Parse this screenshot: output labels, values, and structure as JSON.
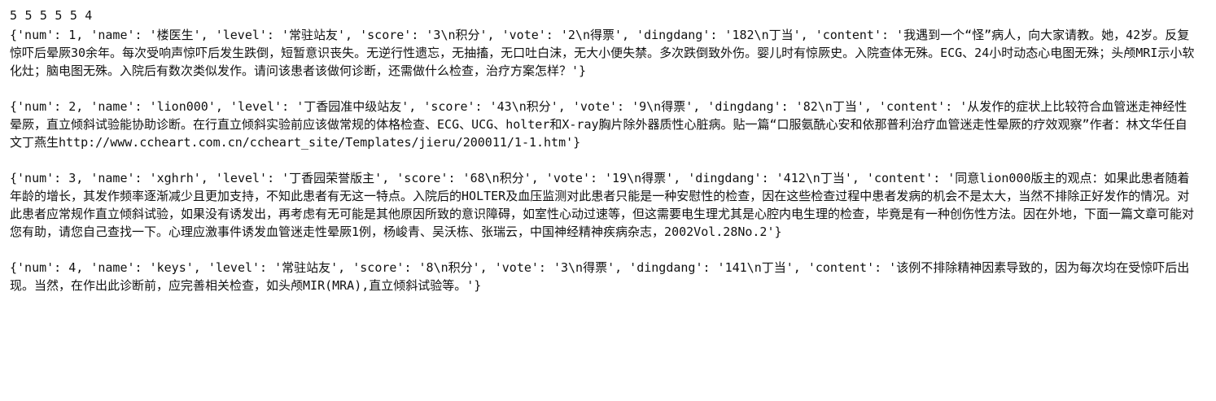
{
  "header": {
    "line": "5 5 5 5 5 4"
  },
  "records": [
    "{'num': 1, 'name': '楼医生', 'level': '常驻站友', 'score': '3\\n积分', 'vote': '2\\n得票', 'dingdang': '182\\n丁当', 'content': '我遇到一个“怪”病人，向大家请教。她，42岁。反复惊吓后晕厥30余年。每次受响声惊吓后发生跌倒，短暂意识丧失。无逆行性遗忘，无抽搐，无口吐白沫，无大小便失禁。多次跌倒致外伤。婴儿时有惊厥史。入院查体无殊。ECG、24小时动态心电图无殊；头颅MRI示小软化灶；脑电图无殊。入院后有数次类似发作。请问该患者该做何诊断，还需做什么检查，治疗方案怎样？'}",
    "{'num': 2, 'name': 'lion000', 'level': '丁香园准中级站友', 'score': '43\\n积分', 'vote': '9\\n得票', 'dingdang': '82\\n丁当', 'content': '从发作的症状上比较符合血管迷走神经性晕厥，直立倾斜试验能协助诊断。在行直立倾斜实验前应该做常规的体格检查、ECG、UCG、holter和X-ray胸片除外器质性心脏病。贴一篇“口服氨酰心安和依那普利治疗血管迷走性晕厥的疗效观察”作者：林文华任自文丁燕生http://www.ccheart.com.cn/ccheart_site/Templates/jieru/200011/1-1.htm'}",
    "{'num': 3, 'name': 'xghrh', 'level': '丁香园荣誉版主', 'score': '68\\n积分', 'vote': '19\\n得票', 'dingdang': '412\\n丁当', 'content': '同意lion000版主的观点：如果此患者随着年龄的增长，其发作频率逐渐减少且更加支持，不知此患者有无这一特点。入院后的HOLTER及血压监测对此患者只能是一种安慰性的检查，因在这些检查过程中患者发病的机会不是太大，当然不排除正好发作的情况。对此患者应常规作直立倾斜试验，如果没有诱发出，再考虑有无可能是其他原因所致的意识障碍，如室性心动过速等，但这需要电生理尤其是心腔内电生理的检查，毕竟是有一种创伤性方法。因在外地，下面一篇文章可能对您有助，请您自己查找一下。心理应激事件诱发血管迷走性晕厥1例，杨峻青、吴沃栋、张瑞云，中国神经精神疾病杂志，2002Vol.28No.2'}",
    "{'num': 4, 'name': 'keys', 'level': '常驻站友', 'score': '8\\n积分', 'vote': '3\\n得票', 'dingdang': '141\\n丁当', 'content': '该例不排除精神因素导致的，因为每次均在受惊吓后出现。当然，在作出此诊断前，应完善相关检查，如头颅MIR(MRA),直立倾斜试验等。'}"
  ]
}
